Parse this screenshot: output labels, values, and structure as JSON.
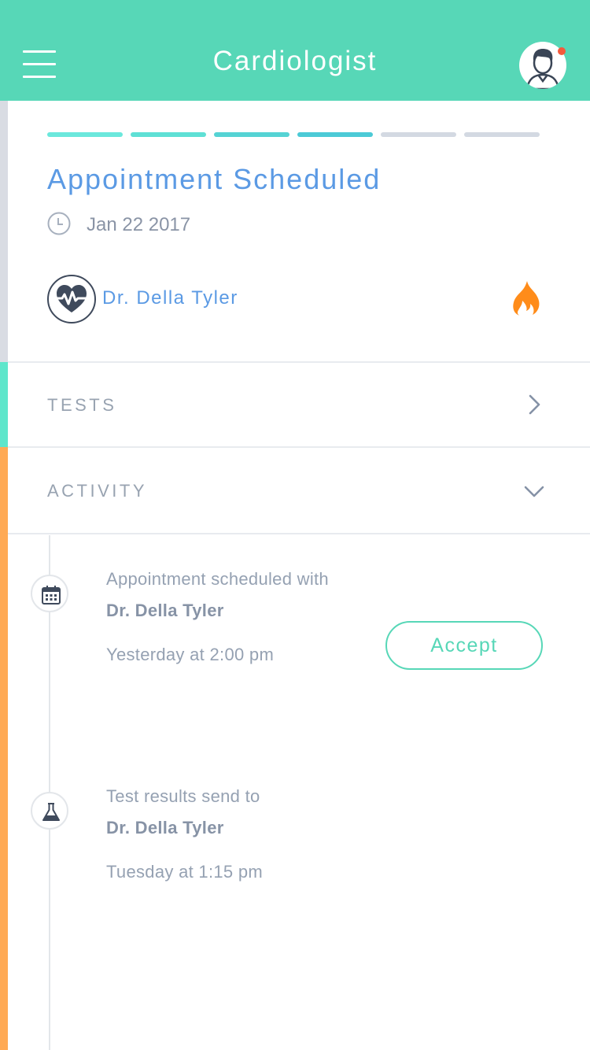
{
  "header": {
    "title": "Cardiologist",
    "background": "#57d7b7",
    "menu_icon": "hamburger-menu-icon",
    "avatar_icon": "user-avatar-icon",
    "notification_color": "#f55a3c"
  },
  "appointment": {
    "title": "Appointment Scheduled",
    "date": "Jan 22 2017",
    "doctor": "Dr. Della Tyler",
    "doctor_icon": "heart-rate-icon",
    "priority_icon": "fire-icon",
    "progress": {
      "total_steps": 6,
      "completed_steps": 4
    }
  },
  "sections": {
    "tests": {
      "label": "TESTS",
      "icon": "chevron-right-icon"
    },
    "activity": {
      "label": "ACTIVITY",
      "icon": "chevron-down-icon"
    }
  },
  "activity": [
    {
      "icon": "calendar-icon",
      "line1": "Appointment scheduled with",
      "line2": "Dr. Della Tyler",
      "time": "Yesterday at 2:00 pm",
      "action_label": "Accept"
    },
    {
      "icon": "flask-icon",
      "line1": "Test results send to",
      "line2": "Dr. Della Tyler",
      "time": "Tuesday at 1:15 pm"
    }
  ],
  "colors": {
    "accent": "#57d7b7",
    "title_blue": "#5b9ae4",
    "strip_teal": "#5ee6cb",
    "strip_orange": "#ffaa55",
    "fire_orange": "#ff8c1a"
  }
}
